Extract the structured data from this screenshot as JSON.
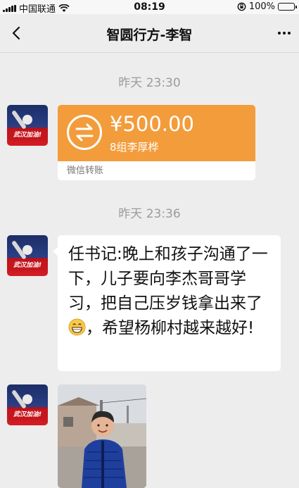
{
  "status_bar": {
    "carrier": "中国联通",
    "time": "08:19",
    "battery": "100%"
  },
  "nav": {
    "title": "智圆行方-李智"
  },
  "messages": [
    {
      "timestamp": "昨天 23:30"
    },
    {
      "timestamp": "昨天 23:36"
    }
  ],
  "transfer": {
    "amount": "¥500.00",
    "note": "8组李厚桦",
    "source": "微信转账"
  },
  "text_message": {
    "part1": "任书记:晚上和孩子沟通了一下，儿子要向李杰哥哥学习，把自己压岁钱拿出来了",
    "part2": "，希望杨柳村越来越好!"
  },
  "avatar": {
    "slogan": "武汉加油!"
  },
  "colors": {
    "transfer_orange": "#f39c3b",
    "chat_background": "#ededed",
    "avatar_red": "#c4161c"
  }
}
